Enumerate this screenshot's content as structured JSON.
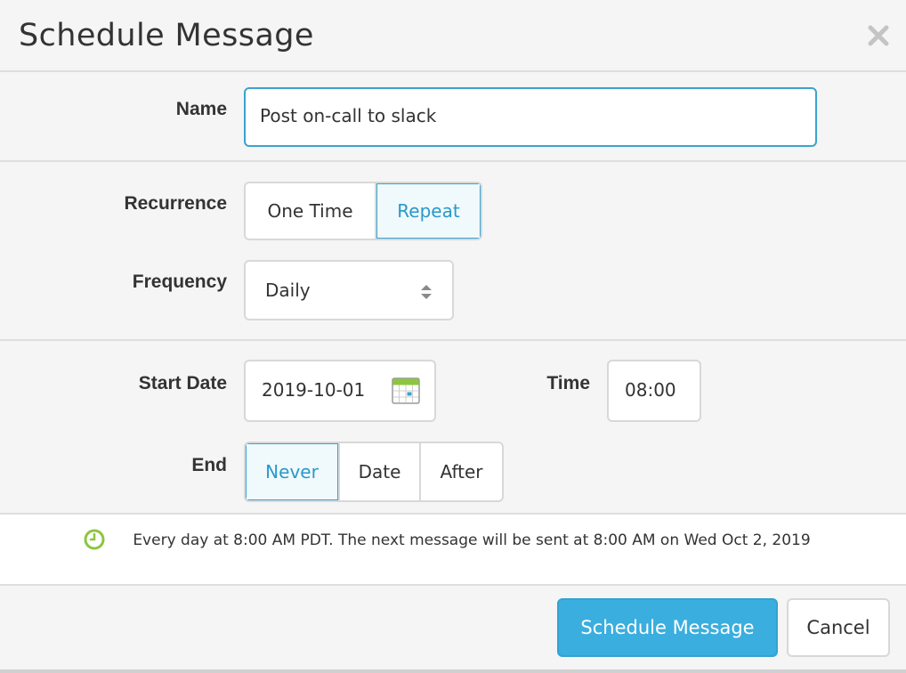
{
  "dialog": {
    "title": "Schedule Message",
    "close_icon": "close-icon"
  },
  "name": {
    "label": "Name",
    "value": "Post on-call to slack"
  },
  "recurrence": {
    "label": "Recurrence",
    "options": [
      "One Time",
      "Repeat"
    ],
    "selected": "Repeat"
  },
  "frequency": {
    "label": "Frequency",
    "value": "Daily",
    "icon": "sort-arrows-icon"
  },
  "start_date": {
    "label": "Start Date",
    "value": "2019-10-01",
    "icon": "calendar-icon"
  },
  "time": {
    "label": "Time",
    "value": "08:00"
  },
  "end": {
    "label": "End",
    "options": [
      "Never",
      "Date",
      "After"
    ],
    "selected": "Never"
  },
  "summary": {
    "icon": "clock-icon",
    "text": "Every day at 8:00 AM PDT. The next message will be sent at 8:00 AM on Wed Oct 2, 2019"
  },
  "footer": {
    "primary_label": "Schedule Message",
    "secondary_label": "Cancel"
  },
  "colors": {
    "accent": "#3aaede",
    "active_text": "#2899c9",
    "clock": "#8cc63f",
    "calendar_top": "#8cc63f",
    "calendar_dot": "#3aa3cf"
  }
}
